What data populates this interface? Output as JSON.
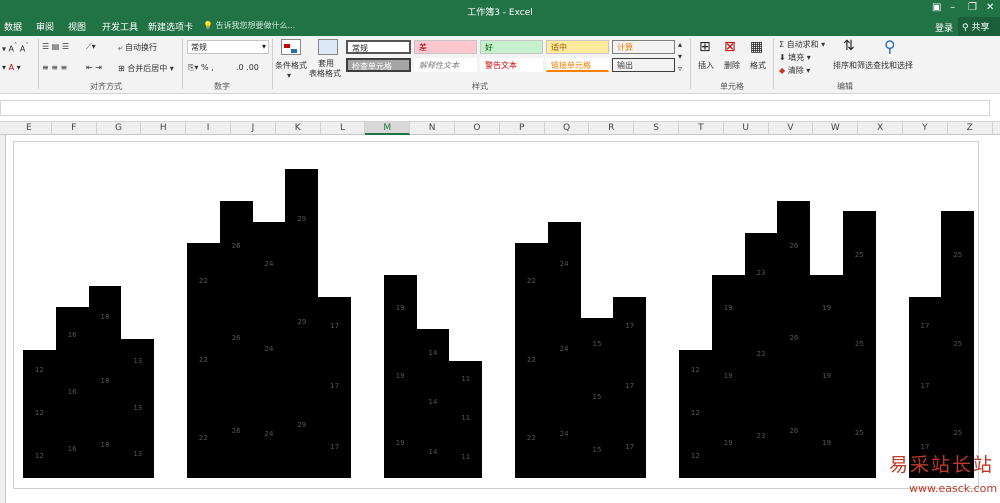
{
  "window": {
    "title": "工作簿3 - Excel",
    "login": "登录",
    "share": "共享"
  },
  "tabs": [
    "数据",
    "审阅",
    "视图",
    "开发工具",
    "新建选项卡"
  ],
  "tell_me": "告诉我您想要做什么...",
  "ribbon": {
    "alignment": {
      "wrap_text": "自动换行",
      "merge_center": "合并后居中",
      "group_label": "对齐方式"
    },
    "number": {
      "format_value": "常规",
      "group_label": "数字"
    },
    "styles": {
      "conditional_format": "条件格式",
      "table_format_line1": "套用",
      "table_format_line2": "表格格式",
      "cell_styles": [
        "常规",
        "差",
        "好",
        "适中",
        "计算",
        "检查单元格",
        "解释性文本",
        "警告文本",
        "链接单元格",
        "输出"
      ],
      "group_label": "样式"
    },
    "cells": {
      "insert": "插入",
      "delete": "删除",
      "format": "格式",
      "group_label": "单元格"
    },
    "editing": {
      "autosum": "自动求和",
      "fill": "填充",
      "clear": "清除",
      "sort_filter": "排序和筛选",
      "find_select": "查找和选择",
      "group_label": "编辑"
    }
  },
  "columns": [
    "E",
    "F",
    "G",
    "H",
    "I",
    "J",
    "K",
    "L",
    "M",
    "N",
    "O",
    "P",
    "Q",
    "R",
    "S",
    "T",
    "U",
    "V",
    "W",
    "X",
    "Y",
    "Z"
  ],
  "selected_column": "M",
  "chart_data": {
    "type": "bar",
    "stacked": true,
    "bar_color": "#000000",
    "ylim": [
      0,
      90
    ],
    "groups": [
      {
        "values": [
          12,
          16,
          18,
          13
        ]
      },
      {
        "values": [
          22,
          26,
          24,
          29,
          17
        ]
      },
      {
        "values": [
          19,
          14,
          11
        ]
      },
      {
        "values": [
          22,
          24,
          15,
          17
        ]
      },
      {
        "values": [
          12,
          19,
          23,
          26,
          19,
          25
        ]
      },
      {
        "values": [
          17,
          25
        ]
      }
    ]
  },
  "watermark": {
    "cn": "易采站长站",
    "en": "www.easck.com"
  }
}
